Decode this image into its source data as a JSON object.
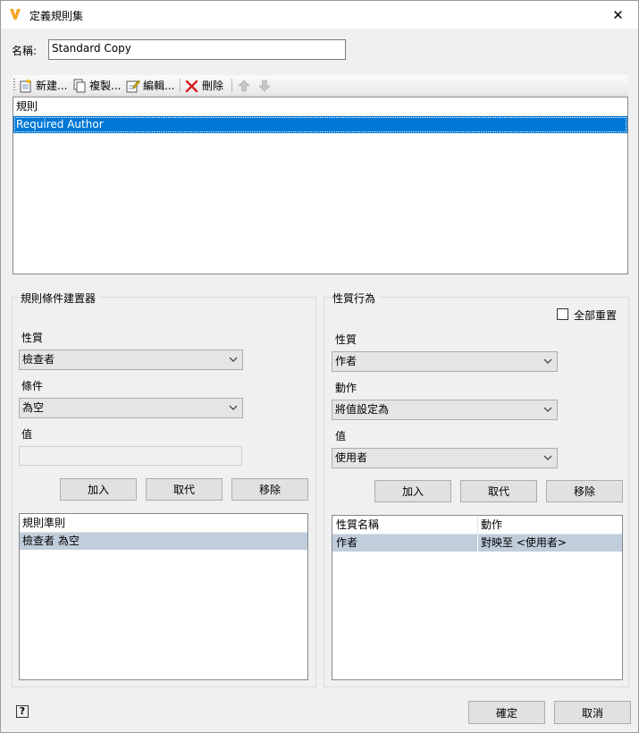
{
  "window": {
    "title": "定義規則集",
    "close_label": "✕"
  },
  "name_field": {
    "label": "名稱:",
    "value": "Standard Copy"
  },
  "toolbar": {
    "new_label": "新建...",
    "copy_label": "複製...",
    "edit_label": "編輯...",
    "delete_label": "刪除"
  },
  "rules_list": {
    "header": "規則",
    "items": [
      "Required Author"
    ]
  },
  "condition_builder": {
    "title": "規則條件建置器",
    "property_label": "性質",
    "property_value": "檢查者",
    "condition_label": "條件",
    "condition_value": "為空",
    "value_label": "值",
    "value_value": "",
    "add_label": "加入",
    "replace_label": "取代",
    "remove_label": "移除",
    "criteria_header": "規則準則",
    "criteria_items": [
      "檢查者 為空"
    ]
  },
  "property_behavior": {
    "title": "性質行為",
    "reset_all_label": "全部重置",
    "reset_all_checked": false,
    "property_label": "性質",
    "property_value": "作者",
    "action_label": "動作",
    "action_value": "將值設定為",
    "value_label": "值",
    "value_value": "使用者",
    "add_label": "加入",
    "replace_label": "取代",
    "remove_label": "移除",
    "table_headers": [
      "性質名稱",
      "動作"
    ],
    "table_rows": [
      [
        "作者",
        "對映至 <使用者>"
      ]
    ]
  },
  "footer": {
    "help_label": "?",
    "ok_label": "確定",
    "cancel_label": "取消"
  },
  "colors": {
    "selection_blue": "#0078d7",
    "selection_grey": "#c0cddb",
    "app_icon_orange": "#f5a623"
  }
}
